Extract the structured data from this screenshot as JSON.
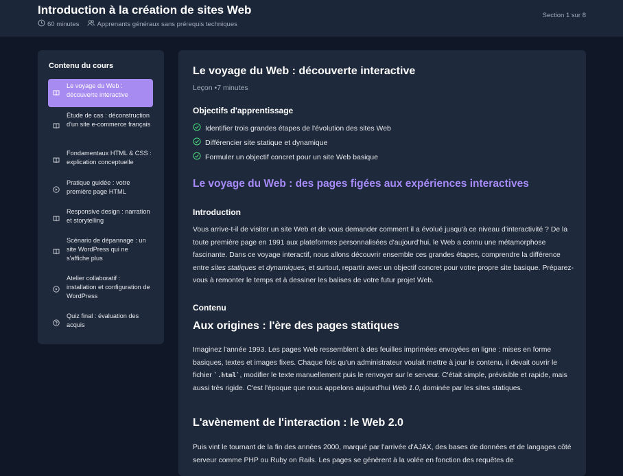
{
  "header": {
    "title": "Introduction à la création de sites Web",
    "duration": "60 minutes",
    "audience": "Apprenants généraux sans prérequis techniques",
    "section_count": "Section 1 sur 8"
  },
  "sidebar": {
    "title": "Contenu du cours",
    "items": [
      {
        "label": "Le voyage du Web : découverte interactive",
        "icon": "book-icon",
        "active": true
      },
      {
        "label": "Étude de cas : déconstruction d'un site e-commerce français",
        "icon": "book-icon"
      },
      {
        "label": "Fondamentaux HTML & CSS : explication conceptuelle",
        "icon": "book-icon"
      },
      {
        "label": "Pratique guidée : votre première page HTML",
        "icon": "play-icon"
      },
      {
        "label": "Responsive design : narration et storytelling",
        "icon": "book-icon"
      },
      {
        "label": "Scénario de dépannage : un site WordPress qui ne s'affiche plus",
        "icon": "book-icon"
      },
      {
        "label": "Atelier collaboratif : installation et configuration de WordPress",
        "icon": "play-icon"
      },
      {
        "label": "Quiz final : évaluation des acquis",
        "icon": "help-icon"
      }
    ]
  },
  "lesson": {
    "title": "Le voyage du Web : découverte interactive",
    "meta": "Leçon •7 minutes",
    "objectives_heading": "Objectifs d'apprentissage",
    "objectives": [
      "Identifier trois grandes étapes de l'évolution des sites Web",
      "Différencier site statique et dynamique",
      "Formuler un objectif concret pour un site Web basique"
    ],
    "content_title": "Le voyage du Web : des pages figées aux expériences interactives",
    "intro_heading": "Introduction",
    "intro_parts": [
      "Vous arrive-t-il de visiter un site Web et de vous demander comment il a évolué jusqu'à ce niveau d'interactivité ? De la toute première page en 1991 aux plateformes personnalisées d'aujourd'hui, le Web a connu une métamorphose fascinante. Dans ce voyage interactif, nous allons découvrir ensemble ces grandes étapes, comprendre la différence entre ",
      "sites statiques",
      " et ",
      "dynamiques",
      ", et surtout, repartir avec un objectif concret pour votre propre site basique. Préparez-vous à remonter le temps et à dessiner les balises de votre futur projet Web."
    ],
    "content_heading": "Contenu",
    "section1_title": "Aux origines : l'ère des pages statiques",
    "section1_parts": [
      "Imaginez l'année 1993. Les pages Web ressemblent à des feuilles imprimées envoyées en ligne : mises en forme basiques, textes et images fixes. Chaque fois qu'un administrateur voulait mettre à jour le contenu, il devait ouvrir le fichier ",
      "`.html`",
      ", modifier le texte manuellement puis le renvoyer sur le serveur. C'était simple, prévisible et rapide, mais aussi très rigide. C'est l'époque que nous appelons aujourd'hui ",
      "Web 1.0",
      ", dominée par les sites statiques."
    ],
    "section2_title": "L'avènement de l'interaction : le Web 2.0",
    "section2_text": "Puis vint le tournant de la fin des années 2000, marqué par l'arrivée d'AJAX, des bases de données et de langages côté serveur comme PHP ou Ruby on Rails. Les pages se génèrent à la volée en fonction des requêtes de"
  }
}
